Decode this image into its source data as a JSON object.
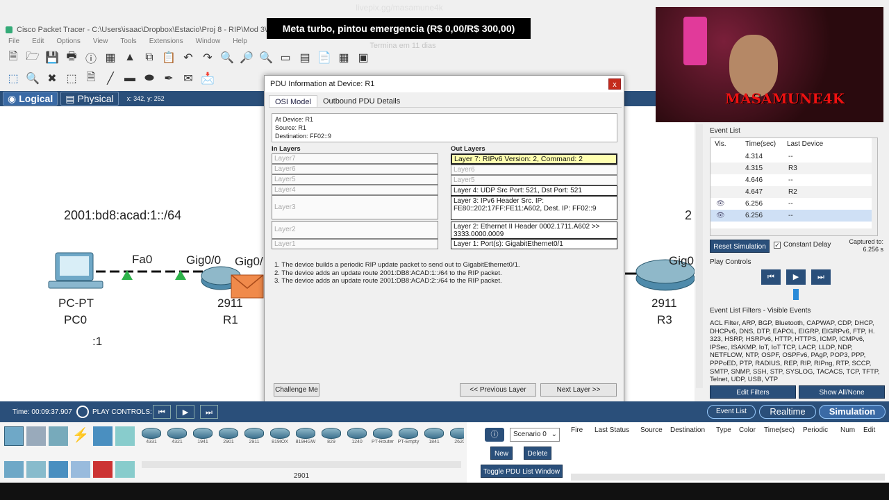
{
  "window": {
    "title": "Cisco Packet Tracer - C:\\Users\\isaac\\Dropbox\\Estacio\\Proj 8 - RIP\\Mod 3\\"
  },
  "menu": [
    "File",
    "Edit",
    "Options",
    "View",
    "Tools",
    "Extensions",
    "Window",
    "Help"
  ],
  "stream": {
    "url": "livepix.gg/masamune4k",
    "goal": "Meta turbo, pintou emergencia (R$ 0,00/R$ 300,00)",
    "goal_sub": "Termina em 11 dias",
    "webcam_text": "MASAMUNE4K"
  },
  "modes": {
    "logical": "Logical",
    "physical": "Physical",
    "coords": "x: 342, y: 252"
  },
  "workspace": {
    "network_label": "2001:bd8:acad:1::/64",
    "right_label": "2",
    "pc": {
      "model": "PC-PT",
      "name": "PC0",
      "note": ":1",
      "port": "Fa0"
    },
    "r1": {
      "model": "2911",
      "name": "R1",
      "port_left": "Gig0/0",
      "port_right": "Gig0/"
    },
    "r3": {
      "model": "2911",
      "name": "R3",
      "port": "Gig0"
    }
  },
  "dialog": {
    "title": "PDU Information at Device: R1",
    "close": "x",
    "tabs": [
      "OSI Model",
      "Outbound PDU Details"
    ],
    "at_device": "At Device: R1",
    "source": "Source: R1",
    "destination": "Destination: FF02::9",
    "in_layers_title": "In Layers",
    "out_layers_title": "Out Layers",
    "in_layers": [
      "Layer7",
      "Layer6",
      "Layer5",
      "Layer4",
      "Layer3",
      "Layer2",
      "Layer1"
    ],
    "out_layers": [
      "Layer 7: RIPv6 Version: 2, Command: 2",
      "Layer6",
      "Layer5",
      "Layer 4: UDP Src Port: 521, Dst Port: 521",
      "Layer 3: IPv6 Header Src. IP: FE80::202:17FF:FE11:A602, Dest. IP: FF02::9",
      "Layer 2: Ethernet II Header 0002.1711.A602 >> 3333.0000.0009",
      "Layer 1: Port(s): GigabitEthernet0/1"
    ],
    "steps": [
      "1. The device builds a periodic RIP update packet to send out to GigabitEthernet0/1.",
      "2. The device adds an update route 2001:DB8:ACAD:1::/64 to the RIP packet.",
      "3. The device adds an update route 2001:DB8:ACAD:2::/64 to the RIP packet."
    ],
    "challenge": "Challenge Me",
    "prev": "<< Previous Layer",
    "next": "Next Layer >>"
  },
  "event_list": {
    "title": "Event List",
    "columns": [
      "Vis.",
      "Time(sec)",
      "Last Device"
    ],
    "rows": [
      {
        "time": "4.314",
        "device": "--"
      },
      {
        "time": "4.315",
        "device": "R3"
      },
      {
        "time": "4.646",
        "device": "--"
      },
      {
        "time": "4.647",
        "device": "R2"
      },
      {
        "time": "6.256",
        "device": "--"
      },
      {
        "time": "6.256",
        "device": "--"
      }
    ],
    "reset": "Reset Simulation",
    "constant_delay": "Constant Delay",
    "captured_label": "Captured to:",
    "captured_value": "6.256 s",
    "play_controls": "Play Controls",
    "filters_title": "Event List Filters - Visible Events",
    "filters_text": "ACL Filter, ARP, BGP, Bluetooth, CAPWAP, CDP, DHCP, DHCPv6, DNS, DTP, EAPOL, EIGRP, EIGRPv6, FTP, H. 323, HSRP, HSRPv6, HTTP, HTTPS, ICMP, ICMPv6, IPSec, ISAKMP, IoT, IoT TCP, LACP, LLDP, NDP, NETFLOW, NTP, OSPF, OSPFv6, PAgP, POP3, PPP, PPPoED, PTP, RADIUS, REP, RIP, RIPng, RTP, SCCP, SMTP, SNMP, SSH, STP, SYSLOG, TACACS, TCP, TFTP, Telnet, UDP, USB, VTP",
    "edit_filters": "Edit Filters",
    "show_all": "Show All/None"
  },
  "bottom": {
    "time": "Time: 00:09:37.907",
    "play_controls": "PLAY CONTROLS:",
    "event_list": "Event List",
    "realtime": "Realtime",
    "simulation": "Simulation"
  },
  "devices": [
    "4331",
    "4321",
    "1941",
    "2901",
    "2911",
    "819IOX",
    "819HGW",
    "829",
    "1240",
    "PT-Router",
    "PT-Empty",
    "1841",
    "2620"
  ],
  "device_selected": "2901",
  "pdu": {
    "scenario": "Scenario 0",
    "new": "New",
    "delete": "Delete",
    "toggle": "Toggle PDU List Window",
    "columns": [
      "Fire",
      "Last Status",
      "Source",
      "Destination",
      "Type",
      "Color",
      "Time(sec)",
      "Periodic",
      "Num",
      "Edit"
    ]
  },
  "colors": {
    "accent": "#2a4f7a",
    "highlight": "#ffffb0",
    "link_green": "#2db34a",
    "envelope": "#f08a4b"
  }
}
